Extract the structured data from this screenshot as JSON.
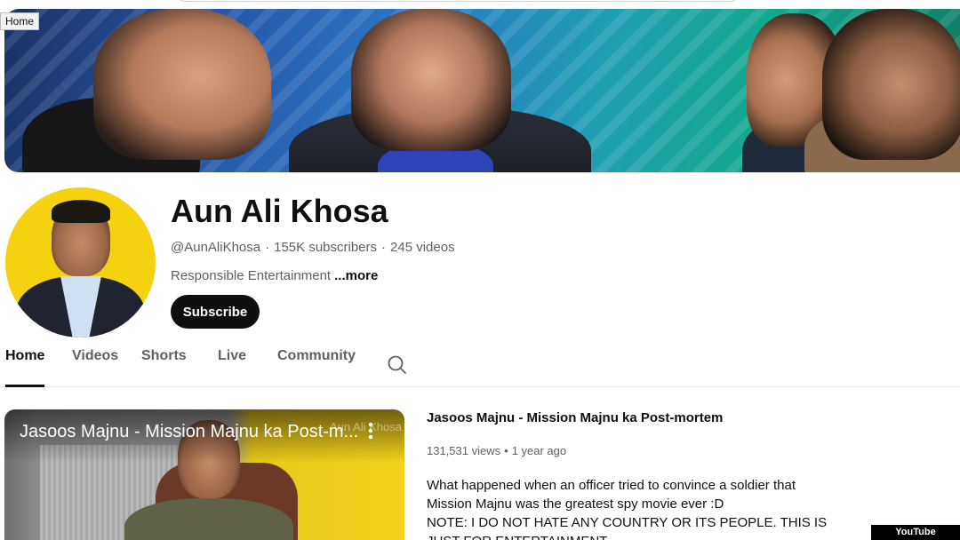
{
  "tooltip": {
    "text": "Home"
  },
  "channel": {
    "name": "Aun Ali Khosa",
    "handle": "@AunAliKhosa",
    "separator": "·",
    "subscribers": "155K subscribers",
    "videos": "245 videos",
    "description": "Responsible Entertainment",
    "more_label": "...more",
    "subscribe_label": "Subscribe"
  },
  "tabs": [
    {
      "label": "Home"
    },
    {
      "label": "Videos"
    },
    {
      "label": "Shorts"
    },
    {
      "label": "Live"
    },
    {
      "label": "Community"
    }
  ],
  "featured": {
    "thumbnail_title": "Jasoos Majnu - Mission Majnu ka Post-m...",
    "watermark": "Aun Ali Khosa",
    "title": "Jasoos Majnu - Mission Majnu ka Post-mortem",
    "views": "131,531 views",
    "dot": "•",
    "age": "1 year ago",
    "description_lines": [
      "What happened when an officer tried to convince a soldier that",
      "Mission Majnu was the greatest spy movie ever :D",
      "NOTE: I DO NOT HATE ANY COUNTRY OR ITS PEOPLE. THIS IS",
      "JUST FOR ENTERTAINMENT"
    ]
  },
  "credit": {
    "text": "YouTube Screenshot"
  },
  "icons": {
    "search": "search-icon",
    "more": "more-vert-icon"
  }
}
